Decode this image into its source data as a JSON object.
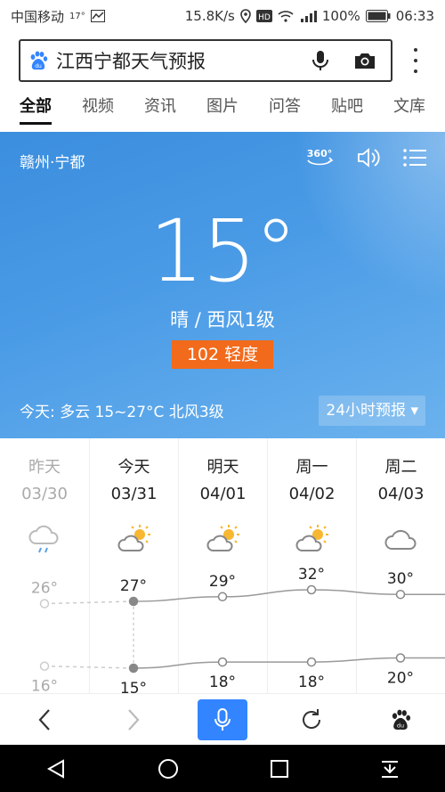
{
  "status": {
    "carrier": "中国移动",
    "temp_small": "17°",
    "speed": "15.8K/s",
    "battery": "100%",
    "time": "06:33"
  },
  "search": {
    "query": "江西宁都天气预报"
  },
  "tabs": [
    {
      "label": "全部",
      "active": true
    },
    {
      "label": "视频"
    },
    {
      "label": "资讯"
    },
    {
      "label": "图片"
    },
    {
      "label": "问答"
    },
    {
      "label": "贴吧"
    },
    {
      "label": "文库"
    }
  ],
  "hero": {
    "location": "赣州·宁都",
    "temp": "15°",
    "condition": "晴 / 西风1级",
    "aqi": "102 轻度",
    "today": "今天:  多云  15~27°C  北风3级",
    "hourly_label": "24小时预报 ▾",
    "colors": {
      "aqi_bg": "#f26a1b",
      "hero_top": "#3b8ede"
    }
  },
  "forecast": {
    "days": [
      {
        "name": "昨天",
        "date": "03/30",
        "icon": "rain-cloud-icon",
        "high": 26,
        "low": 16,
        "past": true
      },
      {
        "name": "今天",
        "date": "03/31",
        "icon": "partly-sunny-icon",
        "high": 27,
        "low": 15
      },
      {
        "name": "明天",
        "date": "04/01",
        "icon": "partly-sunny-icon",
        "high": 29,
        "low": 18
      },
      {
        "name": "周一",
        "date": "04/02",
        "icon": "partly-sunny-icon",
        "high": 32,
        "low": 18
      },
      {
        "name": "周二",
        "date": "04/03",
        "icon": "cloud-icon",
        "high": 30,
        "low": 20
      }
    ]
  },
  "bottom": {
    "accent": "#3385ff"
  }
}
